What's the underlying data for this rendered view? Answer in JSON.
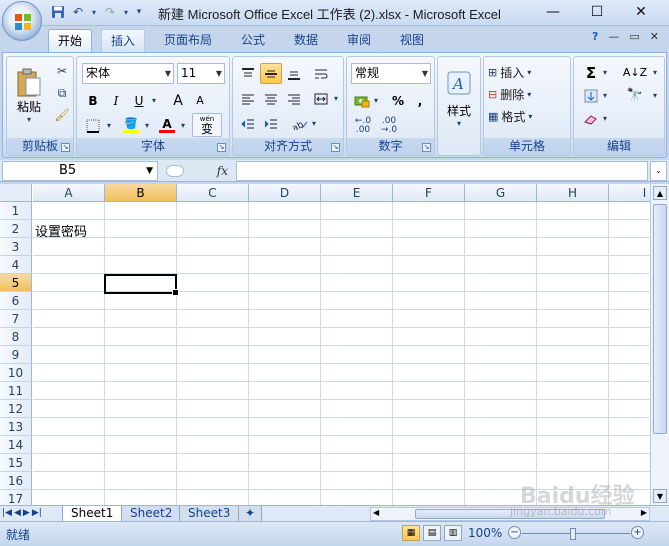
{
  "window": {
    "title": "新建 Microsoft Office Excel 工作表 (2).xlsx - Microsoft Excel",
    "minimize": "—",
    "maximize": "☐",
    "close": "✕"
  },
  "qat": {
    "save": "💾",
    "undo": "↶",
    "redo": "↷",
    "customize": "▾"
  },
  "tabs": [
    {
      "label": "开始"
    },
    {
      "label": "插入"
    },
    {
      "label": "页面布局"
    },
    {
      "label": "公式"
    },
    {
      "label": "数据"
    },
    {
      "label": "审阅"
    },
    {
      "label": "视图"
    }
  ],
  "ribbon_ctl": {
    "help": "?",
    "min": "—",
    "restore": "▭",
    "close": "✕"
  },
  "clipboard": {
    "label": "剪贴板",
    "paste": "粘贴"
  },
  "font": {
    "label": "字体",
    "name": "宋体",
    "size": "11",
    "bold": "B",
    "italic": "I",
    "underline": "U",
    "grow": "A",
    "shrink": "A",
    "fill": "◈",
    "color": "A",
    "wen": "wén",
    "wen_char": "变"
  },
  "alignment": {
    "label": "对齐方式"
  },
  "number": {
    "label": "数字",
    "format": "常规",
    "percent": "%",
    "comma": ",",
    "inc_dec": ".0",
    "dec_dec": ".00"
  },
  "styles": {
    "label": "样式"
  },
  "cells": {
    "label": "单元格",
    "insert": "插入",
    "delete": "删除",
    "format": "格式"
  },
  "editing": {
    "label": "编辑",
    "sum": "Σ"
  },
  "formula_bar": {
    "namebox": "B5",
    "fx": "fx",
    "value": ""
  },
  "columns": [
    "A",
    "B",
    "C",
    "D",
    "E",
    "F",
    "G",
    "H",
    "I"
  ],
  "rows": [
    "1",
    "2",
    "3",
    "4",
    "5",
    "6",
    "7",
    "8",
    "9",
    "10",
    "11",
    "12",
    "13",
    "14",
    "15",
    "16",
    "17"
  ],
  "cells_data": {
    "A2": "设置密码"
  },
  "selected_cell": "B5",
  "sheets": [
    {
      "name": "Sheet1"
    },
    {
      "name": "Sheet2"
    },
    {
      "name": "Sheet3"
    }
  ],
  "status": {
    "ready": "就绪",
    "zoom": "100%"
  },
  "watermark": {
    "text": "Baidu经验",
    "url": "jingyan.baidu.com"
  }
}
